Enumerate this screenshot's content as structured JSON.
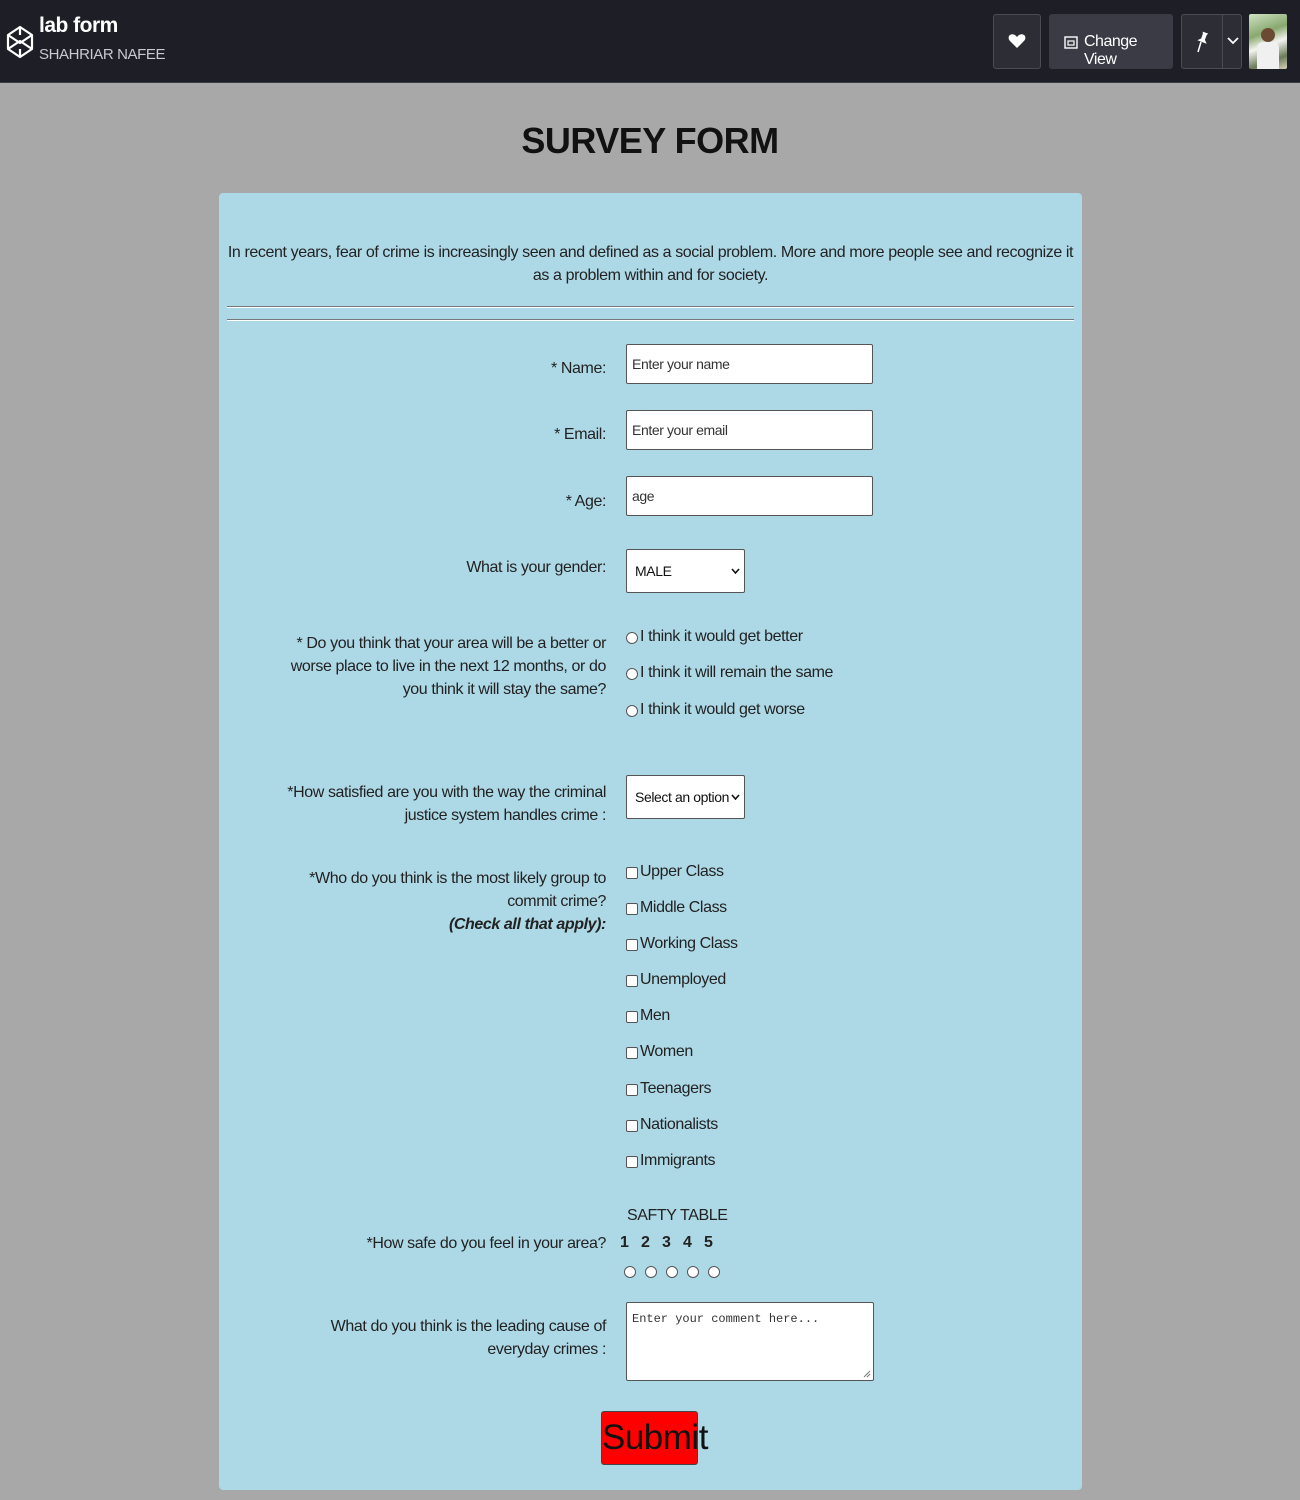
{
  "header": {
    "title": "lab form",
    "author": "SHAHRIAR NAFEE",
    "change_view_label": "Change View"
  },
  "page": {
    "title": "SURVEY FORM"
  },
  "form": {
    "intro": "In recent years, fear of crime is increasingly seen and defined as a social problem. More and more people see and recognize it as a problem within and for society.",
    "name_label": "* Name:",
    "name_placeholder": "Enter your name",
    "email_label": "* Email:",
    "email_placeholder": "Enter your email",
    "age_label": "* Age:",
    "age_placeholder": "age",
    "gender_label": "What is your gender:",
    "gender_value": "MALE",
    "area_question": "* Do you think that your area will be a better or worse place to live in the next 12 months, or do you think it will stay the same?",
    "area_options": [
      "I think it would get better",
      "I think it will remain the same",
      "I think it would get worse"
    ],
    "justice_question": "*How satisfied are you with the way the criminal justice system handles crime :",
    "justice_value": "Select an option",
    "group_question": "*Who do you think is the most likely group to commit crime?",
    "group_hint": "(Check all that apply):",
    "group_options": [
      "Upper Class",
      "Middle Class",
      "Working Class",
      "Unemployed",
      "Men",
      "Women",
      "Teenagers",
      "Nationalists",
      "Immigrants"
    ],
    "safety_title": "SAFTY TABLE",
    "safety_question": "*How safe do you feel in your area?",
    "safety_scale": [
      "1",
      "2",
      "3",
      "4",
      "5"
    ],
    "cause_question": "What do you think is the leading cause of everyday crimes :",
    "cause_placeholder": "Enter your comment here...",
    "submit_label": "Submit"
  }
}
